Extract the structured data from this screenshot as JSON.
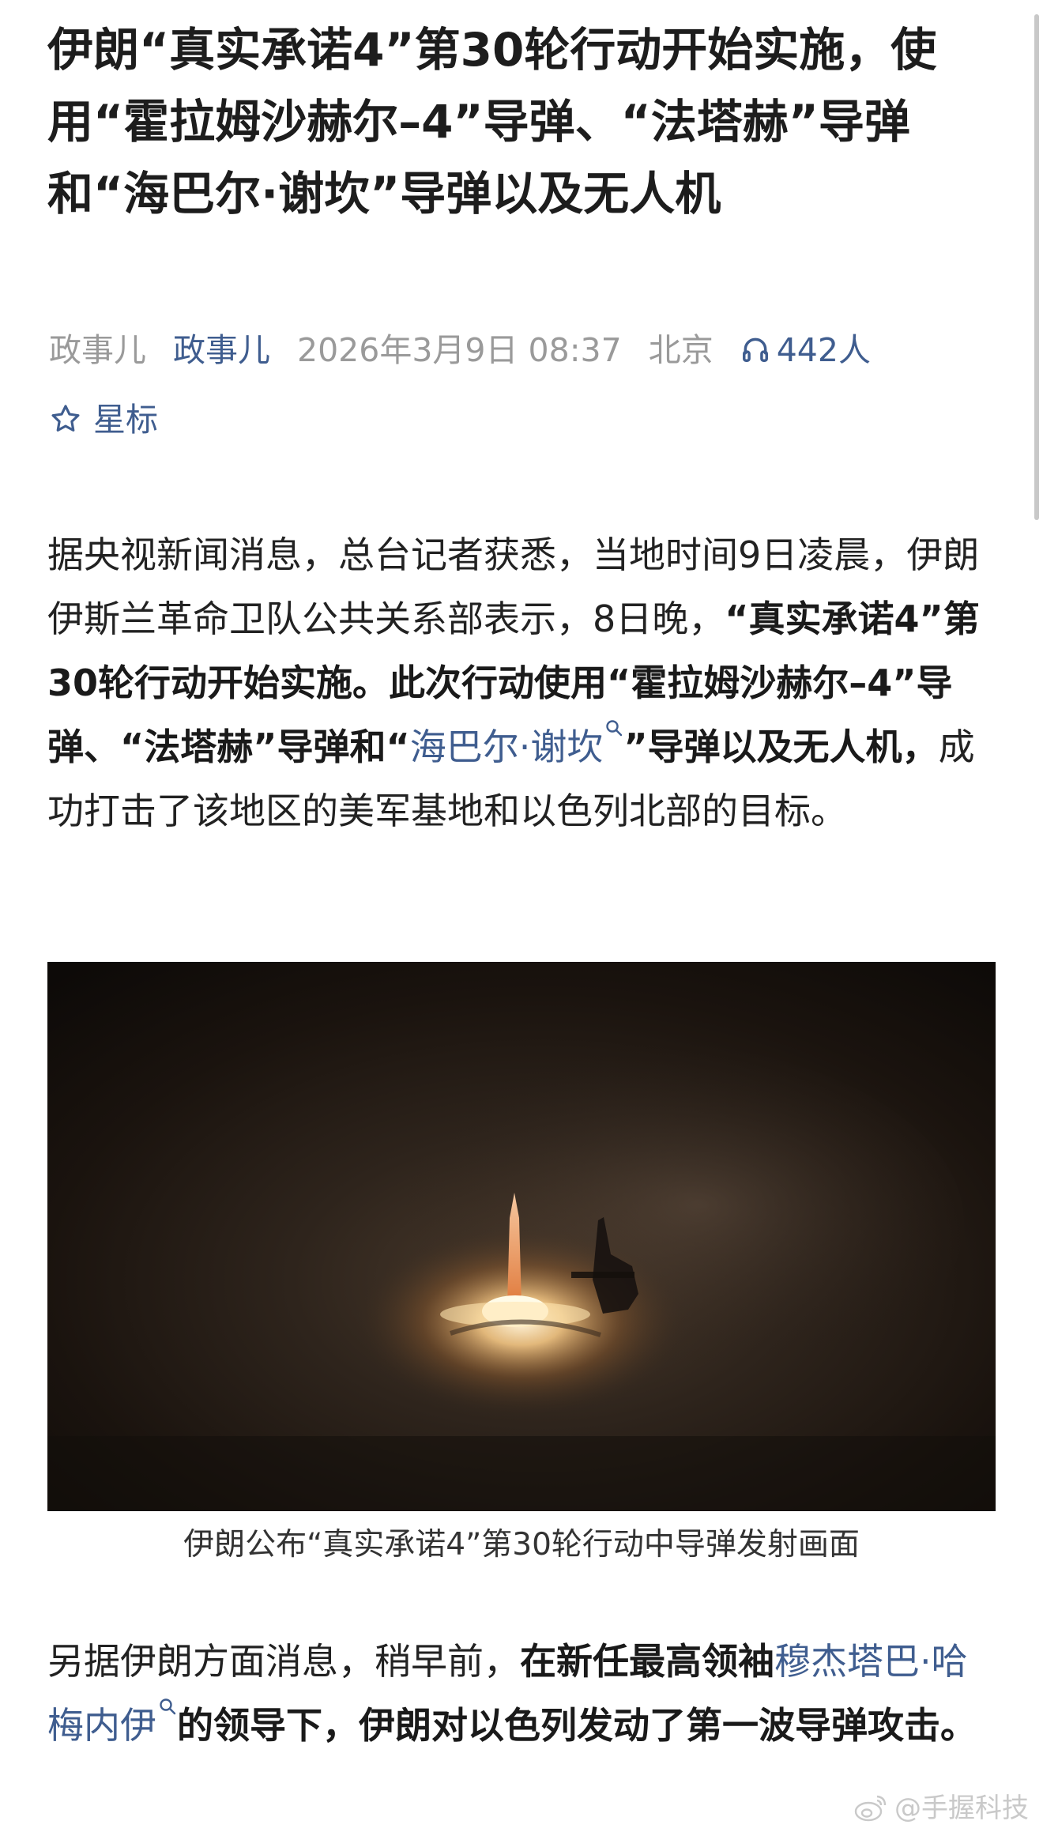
{
  "article": {
    "title": "伊朗“真实承诺4”第30轮行动开始实施，使用“霍拉姆沙赫尔–4”导弹、“法塔赫”导弹和“海巴尔·谢坎”导弹以及无人机"
  },
  "meta": {
    "source": "政事儿",
    "author": "政事儿",
    "datetime": "2026年3月9日 08:37",
    "location": "北京",
    "listeners": "442人",
    "star_label": "星标"
  },
  "paragraph1": {
    "part1": "据央视新闻消息，总台记者获悉，当地时间9日凌晨，伊朗伊斯兰革命卫队公共关系部表示，8日晚，",
    "bold1": "“真实承诺4”第30轮行动开始实施。此次行动使用“霍拉姆沙赫尔–4”导弹、“法塔赫”导弹和“",
    "link1": "海巴尔·谢坎",
    "bold2": "”导弹以及无人机，",
    "part2": "成功打击了该地区的美军基地和以色列北部的目标。"
  },
  "figure": {
    "caption": "伊朗公布“真实承诺4”第30轮行动中导弹发射画面"
  },
  "paragraph2": {
    "part1": "另据伊朗方面消息，稍早前，",
    "bold1": "在新任最高领袖",
    "link1": "穆杰塔巴·哈梅内伊",
    "bold2": "的领导下，伊朗对以色列发动了第一波导弹攻击。"
  },
  "watermark": {
    "text": "@手握科技"
  },
  "icons": {
    "headphone": "headphone-icon",
    "star": "star-outline-icon",
    "search": "search-icon",
    "weibo": "weibo-icon"
  },
  "colors": {
    "link": "#3f5d8f",
    "meta_gray": "#9a9a9a",
    "text": "#222222"
  }
}
